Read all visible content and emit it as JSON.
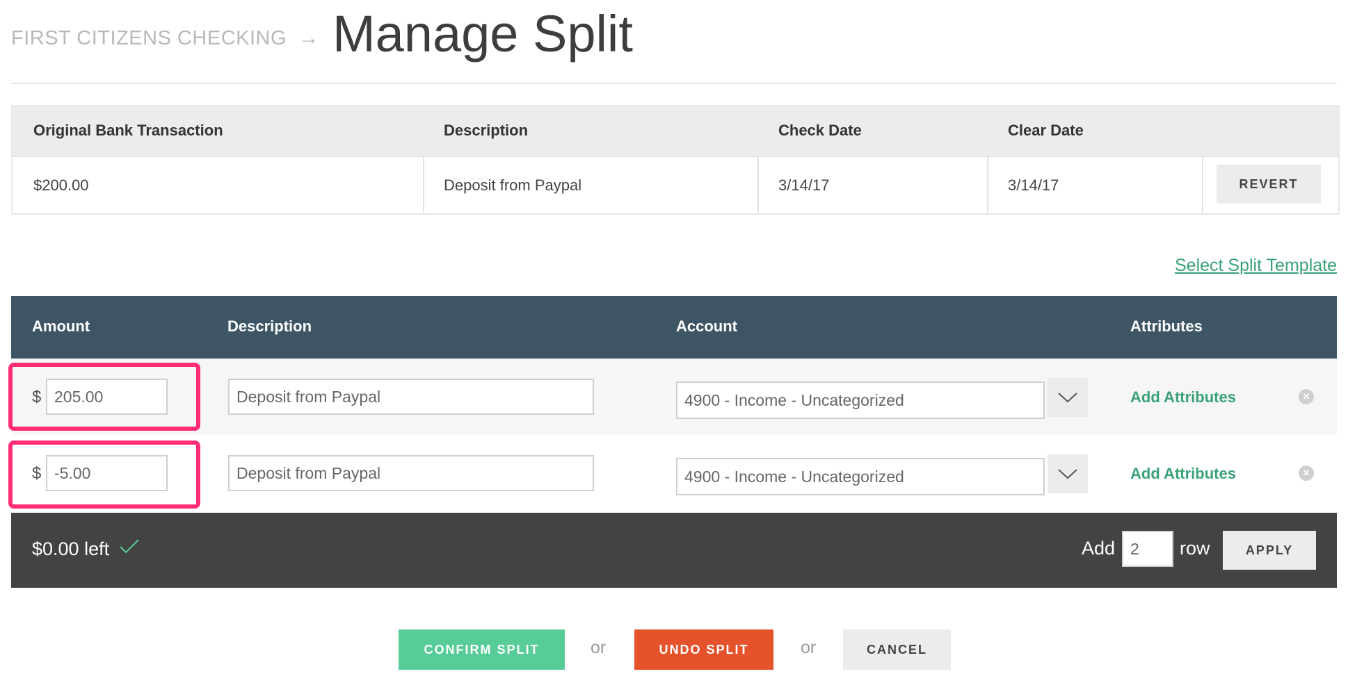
{
  "header": {
    "breadcrumb": "FIRST CITIZENS CHECKING",
    "title": "Manage Split"
  },
  "original_transaction": {
    "headers": [
      "Original Bank Transaction",
      "Description",
      "Check Date",
      "Clear Date"
    ],
    "amount": "$200.00",
    "description": "Deposit from Paypal",
    "check_date": "3/14/17",
    "clear_date": "3/14/17",
    "revert_label": "REVERT"
  },
  "template_link": "Select Split Template",
  "split": {
    "headers": [
      "Amount",
      "Description",
      "Account",
      "Attributes"
    ],
    "currency_symbol": "$",
    "add_attributes_label": "Add Attributes",
    "rows": [
      {
        "amount": "205.00",
        "description": "Deposit from Paypal",
        "account": "4900 - Income - Uncategorized"
      },
      {
        "amount": "-5.00",
        "description": "Deposit from Paypal",
        "account": "4900 - Income - Uncategorized"
      }
    ],
    "highlight_color": "#ff2d78"
  },
  "footer": {
    "left_amount": "$0.00 left",
    "add_label": "Add",
    "rows_count": "2",
    "row_label": "row",
    "apply_label": "APPLY"
  },
  "actions": {
    "confirm_label": "CONFIRM SPLIT",
    "or_label": "or",
    "undo_label": "UNDO SPLIT",
    "cancel_label": "CANCEL"
  },
  "colors": {
    "accent_green": "#57cc97",
    "link_green": "#3aa276",
    "undo_orange": "#e4532c",
    "table_header": "#3e5566",
    "footer_bar": "#434343"
  }
}
